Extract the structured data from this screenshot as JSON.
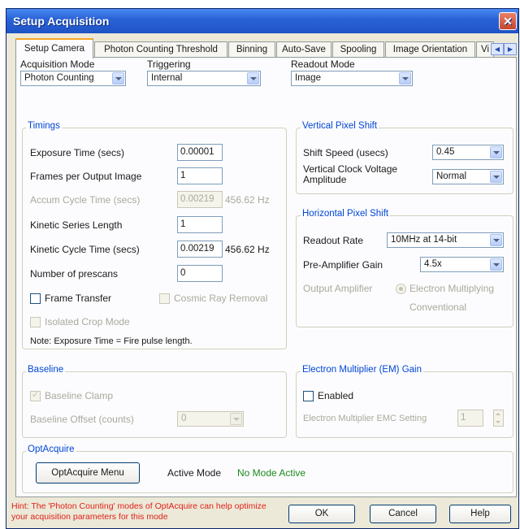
{
  "window": {
    "title": "Setup Acquisition",
    "close_glyph": "✕"
  },
  "tabs": [
    {
      "label": "Setup Camera"
    },
    {
      "label": "Photon Counting Threshold"
    },
    {
      "label": "Binning"
    },
    {
      "label": "Auto-Save"
    },
    {
      "label": "Spooling"
    },
    {
      "label": "Image Orientation"
    },
    {
      "label": "Vi"
    }
  ],
  "top": {
    "acquisition_mode": {
      "label": "Acquisition Mode",
      "value": "Photon Counting"
    },
    "triggering": {
      "label": "Triggering",
      "value": "Internal"
    },
    "readout_mode": {
      "label": "Readout Mode",
      "value": "Image"
    }
  },
  "timings": {
    "title": "Timings",
    "exposure_label": "Exposure Time (secs)",
    "exposure_value": "0.00001",
    "frames_label": "Frames per Output Image",
    "frames_value": "1",
    "accum_label": "Accum Cycle Time (secs)",
    "accum_value": "0.00219",
    "accum_hz": "456.62 Hz",
    "kinetic_len_label": "Kinetic Series Length",
    "kinetic_len_value": "1",
    "kinetic_cycle_label": "Kinetic Cycle Time (secs)",
    "kinetic_cycle_value": "0.00219",
    "kinetic_hz": "456.62 Hz",
    "prescans_label": "Number of prescans",
    "prescans_value": "0",
    "frame_transfer_label": "Frame Transfer",
    "cosmic_label": "Cosmic Ray Removal",
    "isolated_label": "Isolated Crop Mode",
    "note": "Note: Exposure Time = Fire pulse length."
  },
  "vertical": {
    "title": "Vertical Pixel Shift",
    "shift_label": "Shift Speed (usecs)",
    "shift_value": "0.45",
    "vclock_label": "Vertical Clock Voltage Amplitude",
    "vclock_value": "Normal"
  },
  "horizontal": {
    "title": "Horizontal Pixel Shift",
    "readout_label": "Readout Rate",
    "readout_value": "10MHz at 14-bit",
    "preamp_label": "Pre-Amplifier Gain",
    "preamp_value": "4.5x",
    "output_label": "Output Amplifier",
    "em_label": "Electron Multiplying",
    "conv_label": "Conventional"
  },
  "baseline": {
    "title": "Baseline",
    "clamp_label": "Baseline Clamp",
    "offset_label": "Baseline Offset (counts)",
    "offset_value": "0"
  },
  "em_gain": {
    "title": "Electron Multiplier (EM) Gain",
    "enabled_label": "Enabled",
    "setting_label": "Electron Multiplier EMC Setting",
    "setting_value": "1"
  },
  "optacquire": {
    "title": "OptAcquire",
    "menu_button": "OptAcquire Menu",
    "active_mode_label": "Active Mode",
    "active_mode_value": "No Mode Active"
  },
  "footer": {
    "hint": "Hint: The 'Photon Counting' modes of OptAcquire can help optimize your acquisition parameters for this mode",
    "ok": "OK",
    "cancel": "Cancel",
    "help": "Help"
  },
  "colors": {
    "title_bar": "#2a63d8",
    "group_title": "#0046d5",
    "active_mode": "#1c8a1c",
    "hint": "#e0201a"
  }
}
